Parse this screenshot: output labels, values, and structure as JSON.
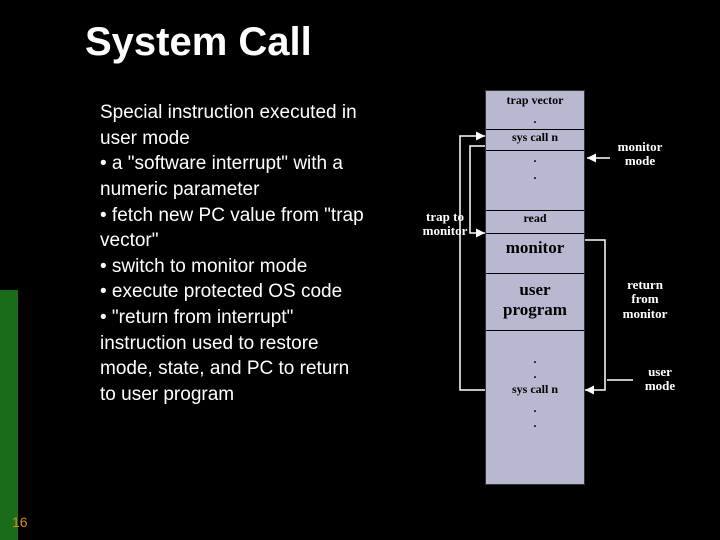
{
  "title": "System Call",
  "body_lines": [
    "Special instruction executed in user mode",
    "• a \"software interrupt\" with a numeric parameter",
    "• fetch new PC value from \"trap vector\"",
    "• switch to monitor mode",
    "• execute protected OS code",
    "• \"return from interrupt\" instruction used to restore mode, state, and PC to return to user program"
  ],
  "page_number": "16",
  "diagram": {
    "trap_vector": "trap vector",
    "dot": ".",
    "syscall": "sys call n",
    "read": "read",
    "monitor": "monitor",
    "user_program": "user\nprogram",
    "labels": {
      "trap_to_monitor": "trap to\nmonitor",
      "monitor_mode": "monitor\nmode",
      "return_from": "return\nfrom\nmonitor",
      "user_mode": "user\nmode"
    }
  }
}
